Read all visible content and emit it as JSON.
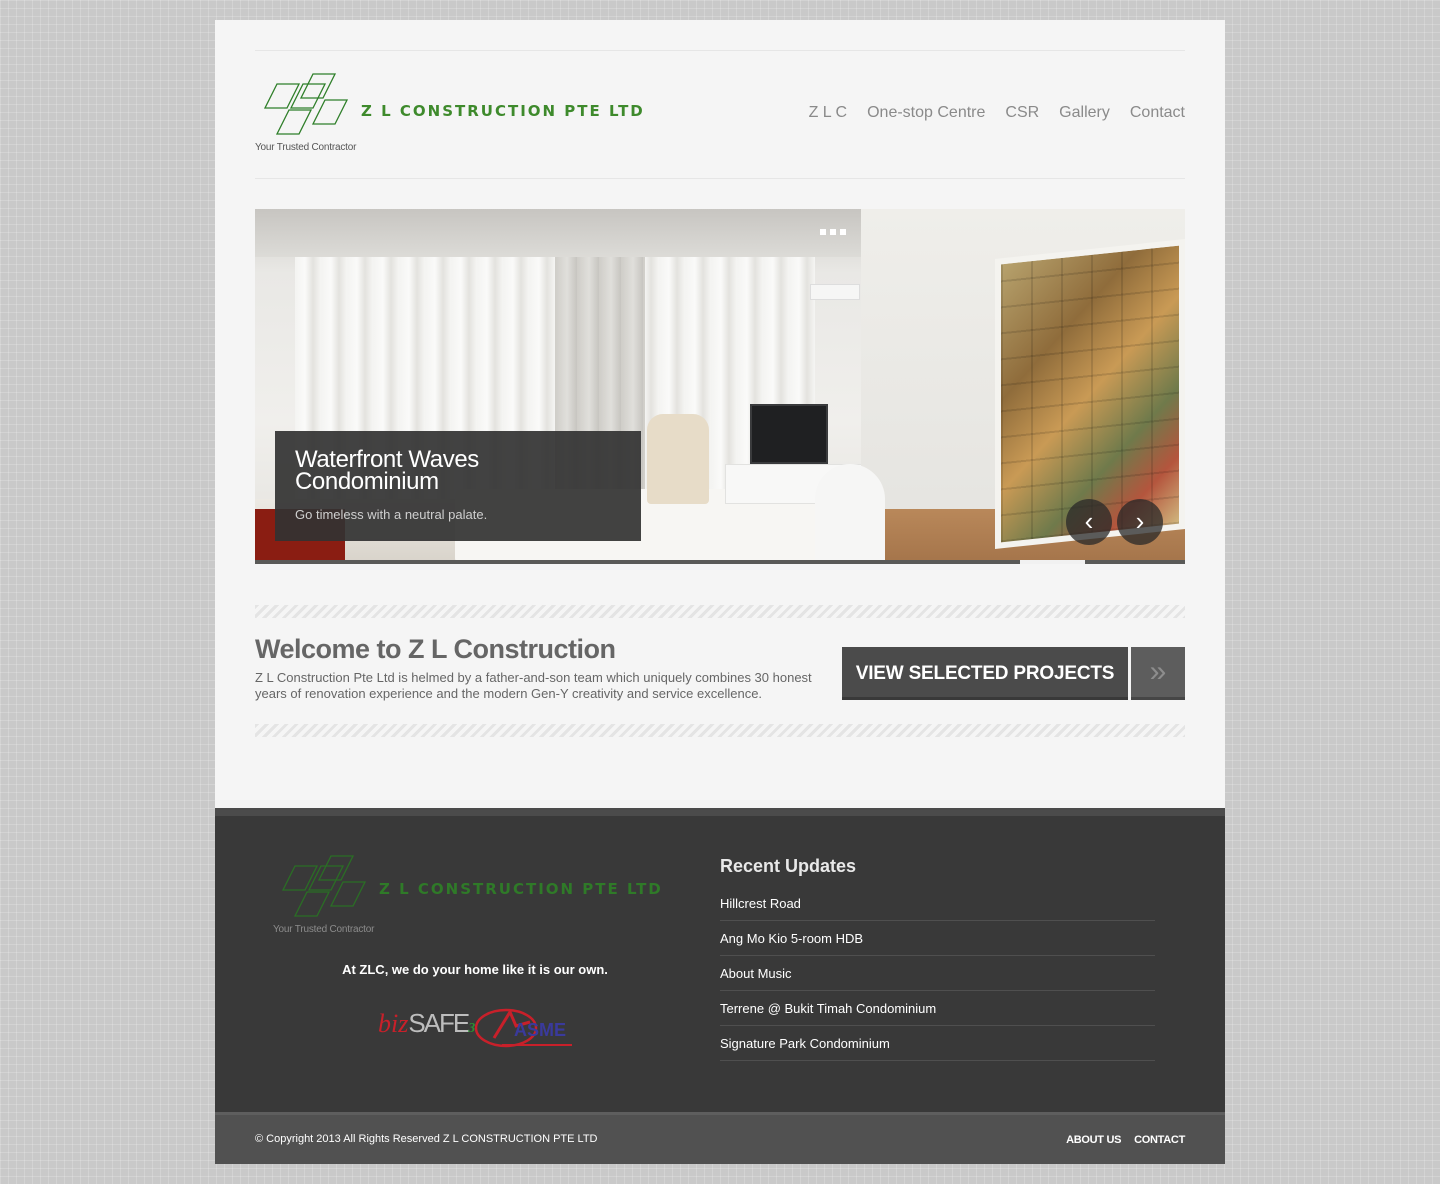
{
  "header": {
    "logo_name": "Z L CONSTRUCTION PTE LTD",
    "logo_tagline": "Your Trusted Contractor",
    "nav": [
      "Z L C",
      "One-stop Centre",
      "CSR",
      "Gallery",
      "Contact"
    ]
  },
  "slider": {
    "caption_title": "Waterfront Waves Condominium",
    "caption_text": "Go timeless with a neutral palate.",
    "prev_glyph": "‹",
    "next_glyph": "›"
  },
  "welcome": {
    "title": "Welcome to Z L Construction",
    "text": "Z L Construction Pte Ltd is helmed by a father-and-son team which uniquely combines 30 honest years of renovation experience and the modern Gen-Y creativity and service excellence.",
    "cta_label": "VIEW SELECTED PROJECTS",
    "cta_arrow": "»"
  },
  "footer": {
    "logo_name": "Z L CONSTRUCTION PTE LTD",
    "logo_tagline": "Your Trusted Contractor",
    "motto": "At ZLC, we do your home like it is our own.",
    "badges": {
      "biz": "biz",
      "safe": "SAFE",
      "three": "3",
      "asme": "ASME"
    },
    "updates_title": "Recent Updates",
    "updates": [
      "Hillcrest Road",
      "Ang Mo Kio 5-room HDB",
      "About Music",
      "Terrene @ Bukit Timah Condominium",
      "Signature Park Condominium"
    ]
  },
  "bottom": {
    "copyright": "© Copyright 2013 All Rights Reserved Z L CONSTRUCTION PTE LTD",
    "links": [
      "ABOUT US",
      "CONTACT"
    ]
  },
  "colors": {
    "brand_green": "#3e8a2c",
    "footer_bg": "#393939",
    "cta_bg": "#4b4b4b"
  }
}
